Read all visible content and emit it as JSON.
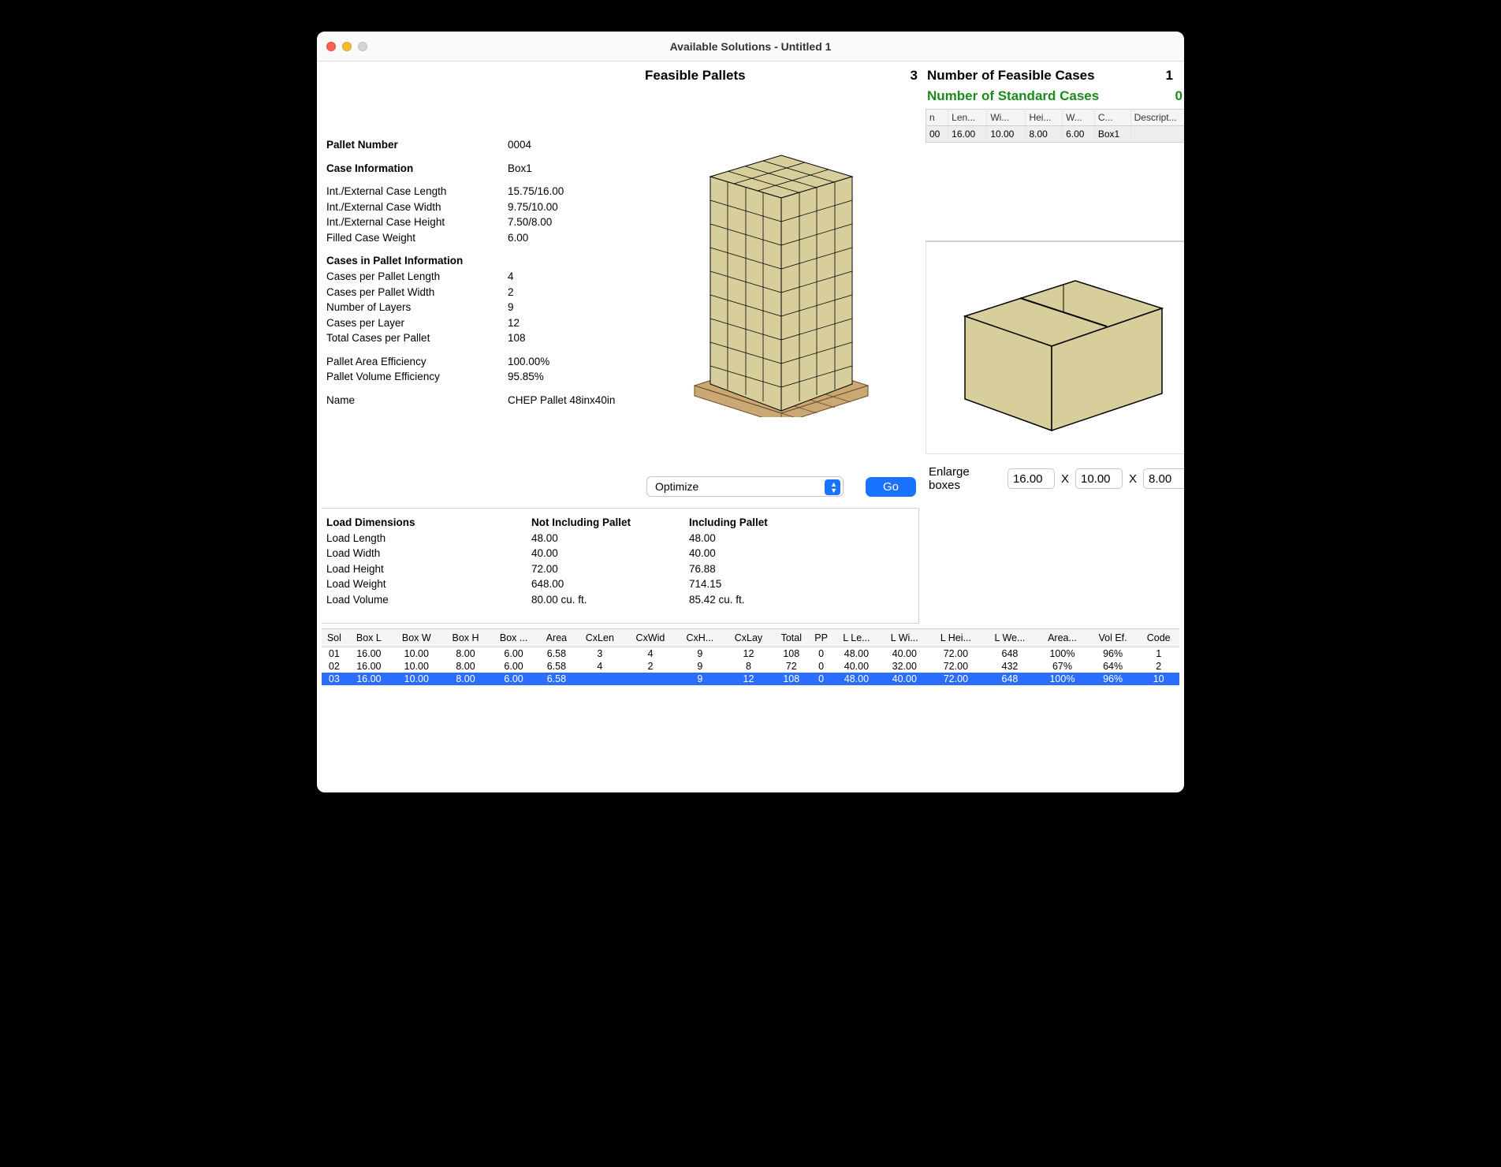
{
  "window": {
    "title": "Available Solutions - Untitled 1"
  },
  "feasible": {
    "label": "Feasible Pallets",
    "count": "3"
  },
  "cases_header": {
    "feasible_label": "Number of Feasible Cases",
    "feasible_count": "1",
    "standard_label": "Number of Standard Cases",
    "standard_count": "0"
  },
  "info": {
    "pallet_number_l": "Pallet Number",
    "pallet_number_v": "0004",
    "case_info_l": "Case Information",
    "case_info_v": "Box1",
    "length_l": "Int./External Case Length",
    "length_v": "15.75/16.00",
    "width_l": "Int./External Case Width",
    "width_v": "9.75/10.00",
    "height_l": "Int./External Case Height",
    "height_v": "7.50/8.00",
    "weight_l": "Filled Case Weight",
    "weight_v": "6.00",
    "cip_l": "Cases in Pallet Information",
    "cpl_l": "Cases per Pallet Length",
    "cpl_v": "4",
    "cpw_l": "Cases per Pallet Width",
    "cpw_v": "2",
    "nl_l": "Number of Layers",
    "nl_v": "9",
    "cplay_l": "Cases per Layer",
    "cplay_v": "12",
    "tcpp_l": "Total Cases per Pallet",
    "tcpp_v": "108",
    "pae_l": "Pallet Area Efficiency",
    "pae_v": "100.00%",
    "pve_l": "Pallet Volume Efficiency",
    "pve_v": "95.85%",
    "name_l": "Name",
    "name_v": "CHEP Pallet 48inx40in"
  },
  "load": {
    "h0": "Load Dimensions",
    "h1": "Not Including Pallet",
    "h2": "Including Pallet",
    "r": [
      {
        "l": "Load Length",
        "a": "48.00",
        "b": "48.00"
      },
      {
        "l": "Load Width",
        "a": "40.00",
        "b": "40.00"
      },
      {
        "l": "Load Height",
        "a": "72.00",
        "b": "76.88"
      },
      {
        "l": "Load Weight",
        "a": "648.00",
        "b": "714.15"
      },
      {
        "l": "Load Volume",
        "a": "80.00 cu. ft.",
        "b": "85.42 cu. ft."
      }
    ]
  },
  "optimize": {
    "select": "Optimize",
    "go": "Go"
  },
  "cases_table": {
    "cols": [
      "n",
      "Len...",
      "Wi...",
      "Hei...",
      "W...",
      "C...",
      "Descript..."
    ],
    "row": [
      "00",
      "16.00",
      "10.00",
      "8.00",
      "6.00",
      "Box1",
      ""
    ]
  },
  "enlarge": {
    "label": "Enlarge boxes",
    "a": "16.00",
    "b": "10.00",
    "c": "8.00",
    "x": "X"
  },
  "solutions": {
    "headers": [
      "Sol",
      "Box L",
      "Box W",
      "Box H",
      "Box ...",
      "Area",
      "CxLen",
      "CxWid",
      "CxH...",
      "CxLay",
      "Total",
      "PP",
      "L Le...",
      "L Wi...",
      "L Hei...",
      "L We...",
      "Area...",
      "Vol Ef.",
      "Code"
    ],
    "rows": [
      [
        "01",
        "16.00",
        "10.00",
        "8.00",
        "6.00",
        "6.58",
        "3",
        "4",
        "9",
        "12",
        "108",
        "0",
        "48.00",
        "40.00",
        "72.00",
        "648",
        "100%",
        "96%",
        "1"
      ],
      [
        "02",
        "16.00",
        "10.00",
        "8.00",
        "6.00",
        "6.58",
        "4",
        "2",
        "9",
        "8",
        "72",
        "0",
        "40.00",
        "32.00",
        "72.00",
        "432",
        "67%",
        "64%",
        "2"
      ],
      [
        "03",
        "16.00",
        "10.00",
        "8.00",
        "6.00",
        "6.58",
        "",
        "",
        "9",
        "12",
        "108",
        "0",
        "48.00",
        "40.00",
        "72.00",
        "648",
        "100%",
        "96%",
        "10"
      ]
    ],
    "selected": 2
  }
}
